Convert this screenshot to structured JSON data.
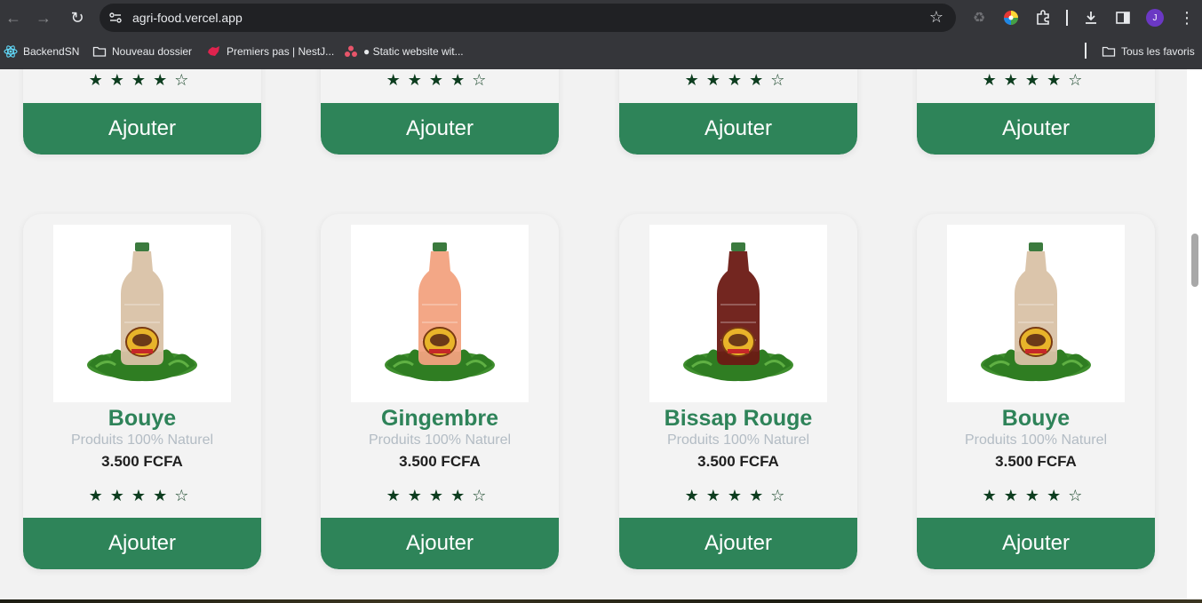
{
  "browser": {
    "url": "agri-food.vercel.app",
    "avatar_letter": "J",
    "bookmarks": [
      {
        "label": "BackendSN"
      },
      {
        "label": "Nouveau dossier"
      },
      {
        "label": "Premiers pas | NestJ..."
      },
      {
        "label": "● Static website wit..."
      }
    ],
    "all_bookmarks_label": "Tous les favoris"
  },
  "page": {
    "top_row": [
      {
        "stars": "★★★★☆",
        "button": "Ajouter"
      },
      {
        "stars": "★★★★☆",
        "button": "Ajouter"
      },
      {
        "stars": "★★★★☆",
        "button": "Ajouter"
      },
      {
        "stars": "★★★★☆",
        "button": "Ajouter"
      }
    ],
    "products": [
      {
        "name": "Bouye",
        "subtitle": "Produits 100% Naturel",
        "price": "3.500 FCFA",
        "stars": "★★★★☆",
        "button": "Ajouter",
        "liquid": "#d9c2a6"
      },
      {
        "name": "Gingembre",
        "subtitle": "Produits 100% Naturel",
        "price": "3.500 FCFA",
        "stars": "★★★★☆",
        "button": "Ajouter",
        "liquid": "#f2a27f"
      },
      {
        "name": "Bissap Rouge",
        "subtitle": "Produits 100% Naturel",
        "price": "3.500 FCFA",
        "stars": "★★★★☆",
        "button": "Ajouter",
        "liquid": "#6b1a14"
      },
      {
        "name": "Bouye",
        "subtitle": "Produits 100% Naturel",
        "price": "3.500 FCFA",
        "stars": "★★★★☆",
        "button": "Ajouter",
        "liquid": "#d9c2a6"
      }
    ]
  },
  "colors": {
    "accent_green": "#2e8459",
    "title_green": "#2e8359",
    "star_color": "#0d3d1f"
  }
}
